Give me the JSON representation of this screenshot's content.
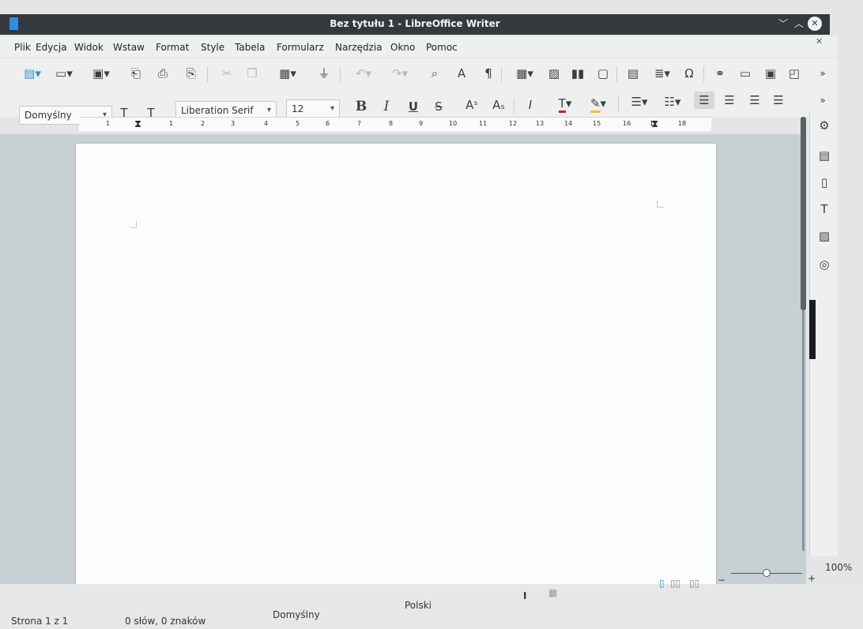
{
  "window": {
    "title": "Bez tytułu 1 - LibreOffice Writer"
  },
  "menu": [
    "Plik",
    "Edycja",
    "Widok",
    "Wstaw",
    "Format",
    "Style",
    "Tabela",
    "Formularz",
    "Narzędzia",
    "Okno",
    "Pomoc"
  ],
  "formatting": {
    "paragraph_style": "Domyślny",
    "font_name": "Liberation Serif",
    "font_size": "12"
  },
  "ruler": {
    "numbers": [
      "1",
      "1",
      "2",
      "3",
      "4",
      "5",
      "6",
      "7",
      "8",
      "9",
      "10",
      "11",
      "12",
      "13",
      "14",
      "15",
      "16",
      "17",
      "18"
    ]
  },
  "status": {
    "page": "Strona 1 z 1",
    "words": "0 słów, 0 znaków",
    "page_style": "Domyślny",
    "language": "Polski",
    "zoom": "100%",
    "zoom_level_percent": 100
  }
}
